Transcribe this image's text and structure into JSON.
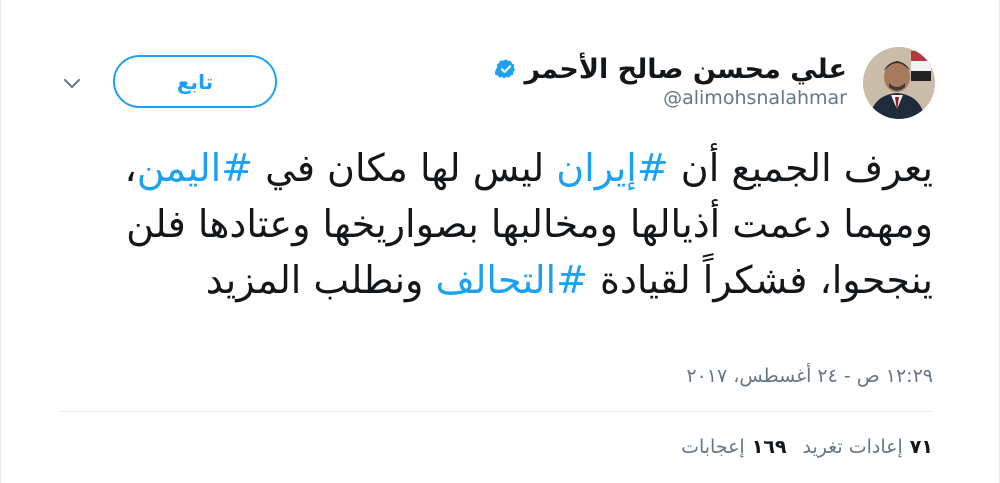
{
  "user": {
    "name": "علي محسن صالح الأحمر",
    "handle": "@alimohsnalahmar"
  },
  "follow_button": {
    "label": "تابع"
  },
  "tweet": {
    "segments": [
      {
        "text": "يعرف الجميع أن ",
        "tag": false
      },
      {
        "text": "#إيران",
        "tag": true
      },
      {
        "text": " ليس لها مكان في ",
        "tag": false
      },
      {
        "text": "#اليمن",
        "tag": true
      },
      {
        "text": "، ومهما دعمت أذيالها ومخالبها بصواريخها وعتادها فلن ينجحوا، فشكراً لقيادة ",
        "tag": false
      },
      {
        "text": "#التحالف",
        "tag": true
      },
      {
        "text": " ونطلب المزيد",
        "tag": false
      }
    ]
  },
  "timestamp": "١٢:٢٩ ص - ٢٤ أغسطس، ٢٠١٧",
  "stats": {
    "retweets": {
      "count": "٧١",
      "label": "إعادات تغريد"
    },
    "likes": {
      "count": "١٦٩",
      "label": "إعجابات"
    }
  },
  "colors": {
    "accent": "#1da1f2",
    "secondary_text": "#657786",
    "divider": "#e6ecf0"
  },
  "icons": {
    "verified": "verified-badge-icon",
    "caret": "chevron-down-icon"
  }
}
